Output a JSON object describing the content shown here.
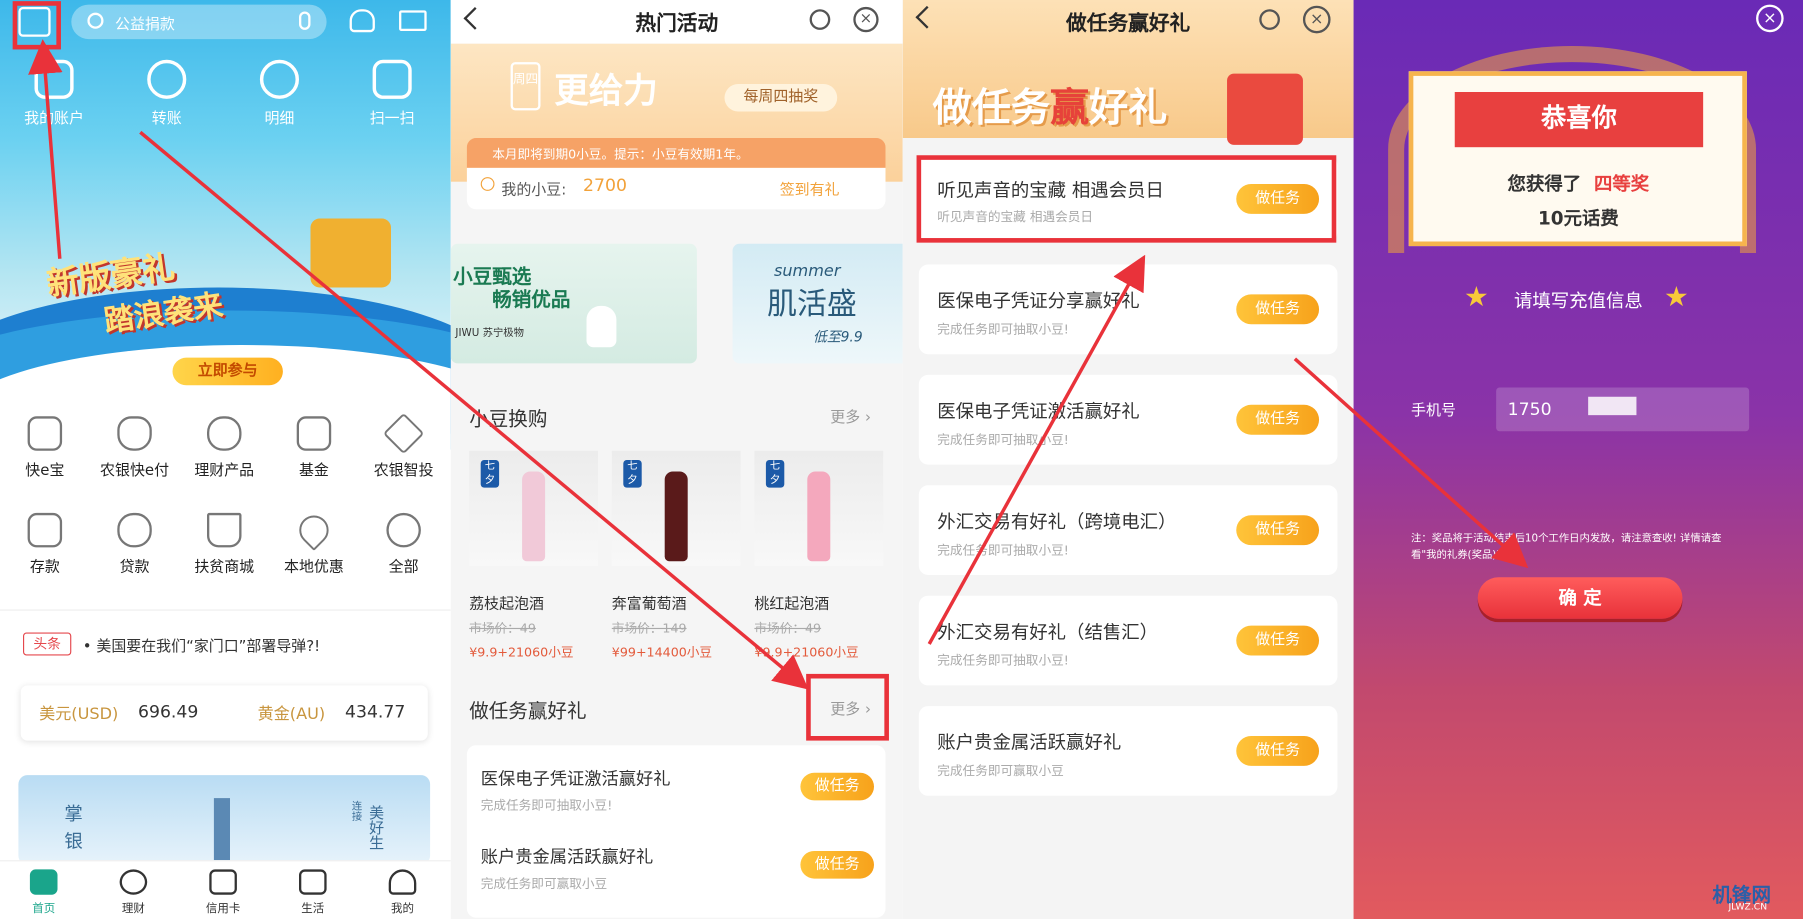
{
  "panel1": {
    "search_placeholder": "公益捐款",
    "quick_actions": [
      "我的账户",
      "转账",
      "明细",
      "扫一扫"
    ],
    "banner_line1": "新版豪礼",
    "banner_line2": "踏浪袭来",
    "banner_button": "立即参与",
    "grid": [
      "快e宝",
      "农银快e付",
      "理财产品",
      "基金",
      "农银智投",
      "存款",
      "贷款",
      "扶贫商城",
      "本地优惠",
      "全部"
    ],
    "news_tag": "头条",
    "news_text": "美国要在我们“家门口”部署导弹?!",
    "usd_label": "美元(USD)",
    "usd_value": "696.49",
    "gold_label": "黄金(AU)",
    "gold_value": "434.77",
    "promo_char1": "掌",
    "promo_char2": "银",
    "promo_right": "美好生",
    "promo_right_small": "连接",
    "tabs": [
      "首页",
      "理财",
      "信用卡",
      "生活",
      "我的"
    ]
  },
  "panel2": {
    "title": "热门活动",
    "hero_text": "更给力",
    "hero_week": "周四",
    "hero_badge": "每周四抽奖",
    "notice": "本月即将到期0小豆。提示：小豆有效期1年。",
    "beans_label": "我的小豆:",
    "beans_value": "2700",
    "sign_label": "签到有礼",
    "promo1_line1": "小豆甄选",
    "promo1_line2": "畅销优品",
    "promo1_brand": "JIWU 苏宁极物",
    "promo2_line1": "summer",
    "promo2_line2": "肌活盛",
    "promo2_price": "低至9.9",
    "exchange_title": "小豆换购",
    "more": "更多",
    "tag_text": "七夕",
    "products": [
      {
        "name": "荔枝起泡酒",
        "market": "市场价：49",
        "price": "¥9.9+21060小豆",
        "color": "#f1c9d8"
      },
      {
        "name": "奔富葡萄酒",
        "market": "市场价：149",
        "price": "¥99+14400小豆",
        "color": "#5a1a1a"
      },
      {
        "name": "桃红起泡酒",
        "market": "市场价：49",
        "price": "¥9.9+21060小豆",
        "color": "#f4a8bd"
      }
    ],
    "task_title": "做任务赢好礼",
    "task_more": "更多",
    "tasks": [
      {
        "title": "医保电子凭证激活赢好礼",
        "sub": "完成任务即可抽取小豆!",
        "btn": "做任务"
      },
      {
        "title": "账户贵金属活跃赢好礼",
        "sub": "完成任务即可赢取小豆",
        "btn": "做任务"
      }
    ]
  },
  "panel3": {
    "title": "做任务赢好礼",
    "hero_text_a": "做任务",
    "hero_text_b": "赢",
    "hero_text_c": "好礼",
    "tasks": [
      {
        "title": "听见声音的宝藏 相遇会员日",
        "sub": "听见声音的宝藏 相遇会员日",
        "btn": "做任务"
      },
      {
        "title": "医保电子凭证分享赢好礼",
        "sub": "完成任务即可抽取小豆!",
        "btn": "做任务"
      },
      {
        "title": "医保电子凭证激活赢好礼",
        "sub": "完成任务即可抽取小豆!",
        "btn": "做任务"
      },
      {
        "title": "外汇交易有好礼（跨境电汇）",
        "sub": "完成任务即可抽取小豆!",
        "btn": "做任务"
      },
      {
        "title": "外汇交易有好礼（结售汇）",
        "sub": "完成任务即可抽取小豆!",
        "btn": "做任务"
      },
      {
        "title": "账户贵金属活跃赢好礼",
        "sub": "完成任务即可赢取小豆",
        "btn": "做任务"
      }
    ]
  },
  "panel4": {
    "congrats": "恭喜你",
    "won_prefix": "您获得了",
    "prize_level": "四等奖",
    "prize": "10元话费",
    "fill_info": "请填写充值信息",
    "phone_label": "手机号",
    "phone_value": "1750",
    "note": "注：奖品将于活动结束后10个工作日内发放，请注意查收! 详情请查看\"我的礼券(奖品)\"",
    "confirm": "确 定",
    "watermark": "机锋网",
    "watermark_url": "JLWZ.CN"
  },
  "colors": {
    "task_button": "#f7a21b",
    "highlight_red": "#e9323a",
    "brand_green": "#1aa58b"
  }
}
